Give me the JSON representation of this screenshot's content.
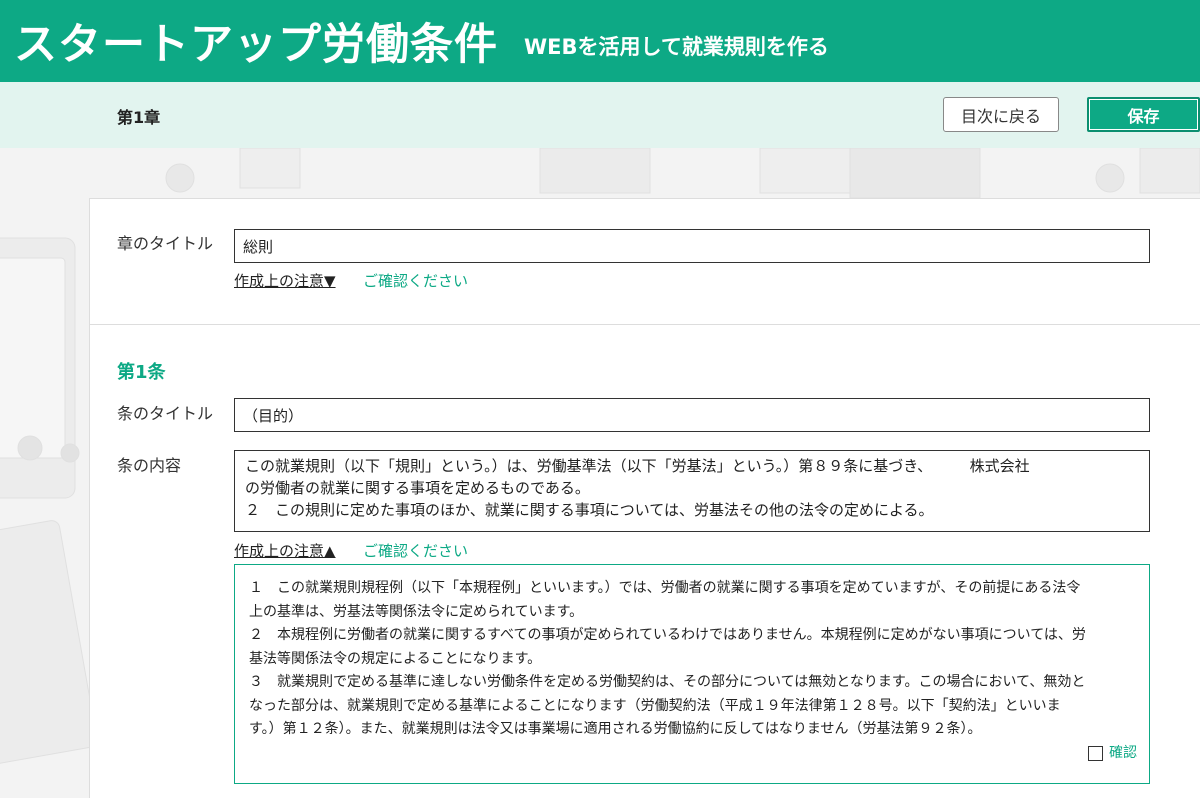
{
  "header": {
    "brand": "スタートアップ労働条件",
    "tagline": "WEBを活用して就業規則を作る"
  },
  "subbar": {
    "chapter": "第1章",
    "toc_button": "目次に戻る",
    "save_button": "保存"
  },
  "chapter_section": {
    "title_label": "章のタイトル",
    "title_value": "総則",
    "note_toggle": "作成上の注意▼",
    "confirm_text": "ご確認ください"
  },
  "article": {
    "heading": "第1条",
    "title_label": "条のタイトル",
    "title_value": "（目的）",
    "content_label": "条の内容",
    "content_lines": [
      "この就業規則（以下「規則」という。）は、労働基準法（以下「労基法」という。）第８９条に基づき、　　　株式会社",
      "の労働者の就業に関する事項を定めるものである。",
      "２　この規則に定めた事項のほか、就業に関する事項については、労基法その他の法令の定めによる。"
    ],
    "note_toggle": "作成上の注意▲",
    "confirm_text": "ご確認ください",
    "notes_lines": [
      "１　この就業規則規程例（以下「本規程例」といいます。）では、労働者の就業に関する事項を定めていますが、その前提にある法令",
      "上の基準は、労基法等関係法令に定められています。",
      "２　本規程例に労働者の就業に関するすべての事項が定められているわけではありません。本規程例に定めがない事項については、労",
      "基法等関係法令の規定によることになります。",
      "３　就業規則で定める基準に達しない労働条件を定める労働契約は、その部分については無効となります。この場合において、無効と",
      "なった部分は、就業規則で定める基準によることになります（労働契約法（平成１９年法律第１２８号。以下「契約法」といいま",
      "す。）第１２条）。また、就業規則は法令又は事業場に適用される労働協約に反してはなりません（労基法第９２条）。"
    ],
    "checkbox_label": "確認",
    "checkbox_checked": false
  },
  "colors": {
    "accent": "#0da985",
    "subbar_bg": "#e2f4ef"
  }
}
